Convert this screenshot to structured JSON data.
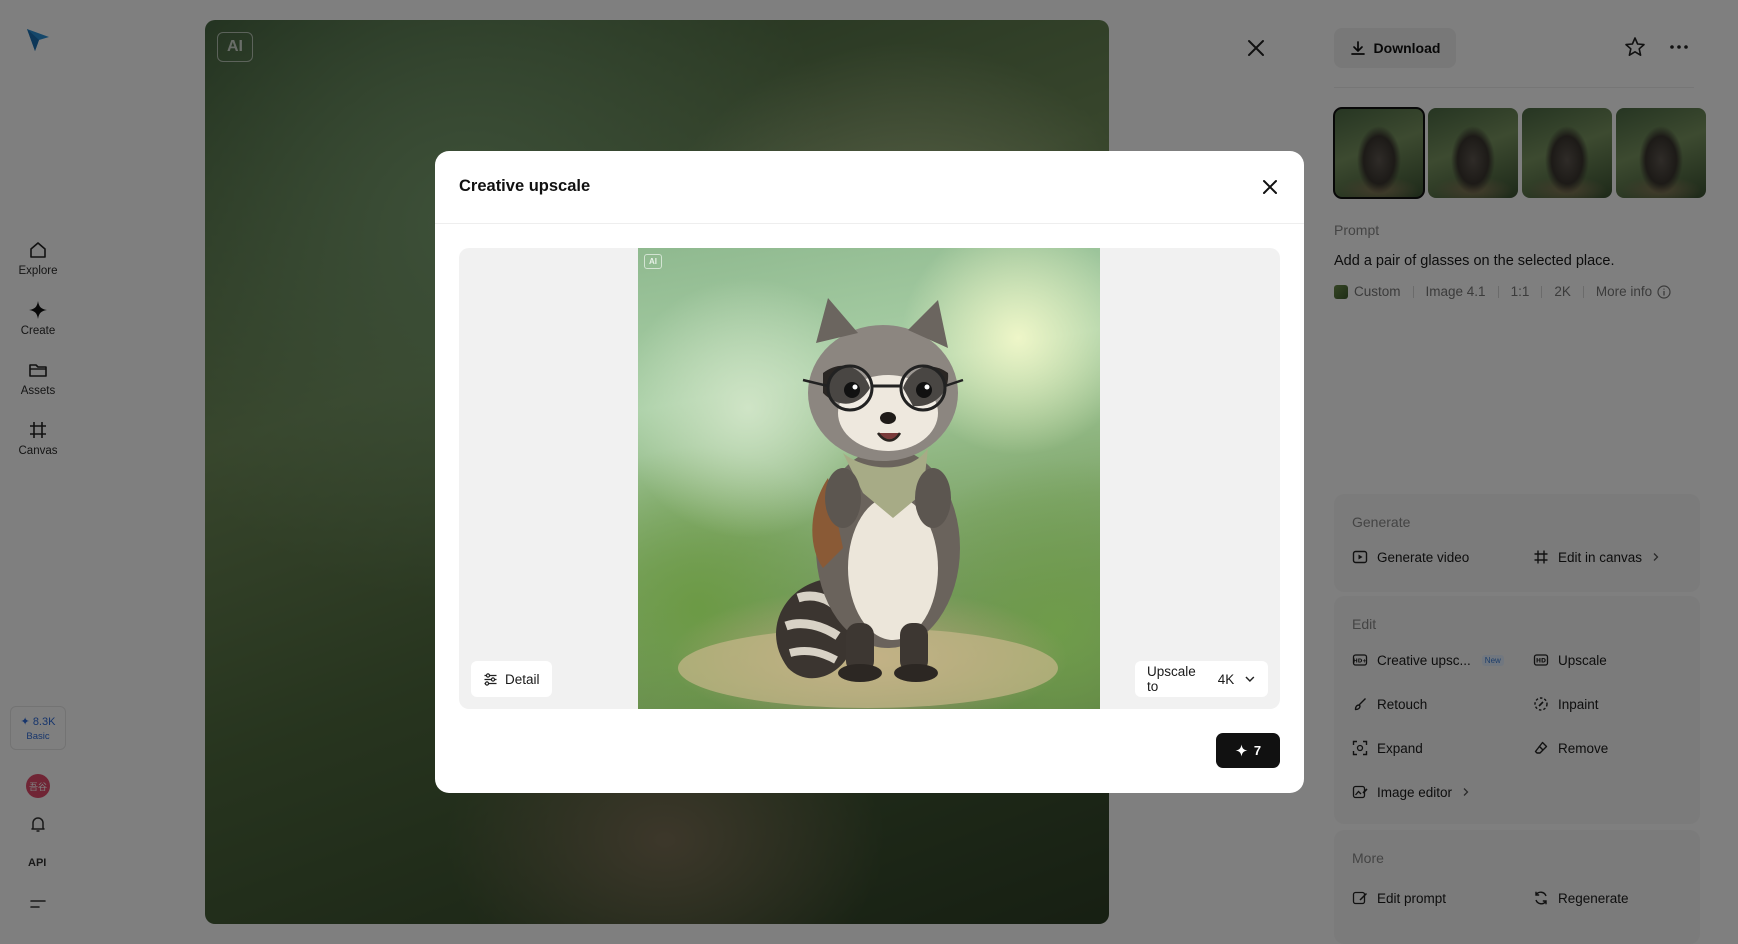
{
  "nav": {
    "items": [
      {
        "label": "Explore",
        "icon": "home-icon"
      },
      {
        "label": "Create",
        "icon": "sparkle-icon"
      },
      {
        "label": "Assets",
        "icon": "folder-icon"
      },
      {
        "label": "Canvas",
        "icon": "frame-icon"
      }
    ],
    "credits": "8.3K",
    "plan": "Basic",
    "avatar_text": "吾谷",
    "api_label": "API"
  },
  "viewer": {
    "ai_tag": "AI"
  },
  "panel": {
    "download_label": "Download",
    "prompt_label": "Prompt",
    "prompt_text": "Add a pair of glasses on the selected place.",
    "meta": {
      "style": "Custom",
      "model": "Image 4.1",
      "ratio": "1:1",
      "resolution": "2K",
      "more_info": "More info"
    },
    "generate": {
      "title": "Generate",
      "generate_video": "Generate video",
      "edit_in_canvas": "Edit in canvas"
    },
    "edit": {
      "title": "Edit",
      "creative_upscale": "Creative upsc...",
      "new_badge": "New",
      "upscale": "Upscale",
      "retouch": "Retouch",
      "inpaint": "Inpaint",
      "expand": "Expand",
      "remove": "Remove",
      "image_editor": "Image editor"
    },
    "more": {
      "title": "More",
      "edit_prompt": "Edit prompt",
      "regenerate": "Regenerate"
    }
  },
  "modal": {
    "title": "Creative upscale",
    "ai_tag": "AI",
    "detail_label": "Detail",
    "upscale_label": "Upscale to",
    "upscale_value": "4K",
    "cost": "7"
  },
  "colors": {
    "accent_blue": "#2e6bd8",
    "primary_button": "#111111",
    "overlay": "#000000"
  }
}
